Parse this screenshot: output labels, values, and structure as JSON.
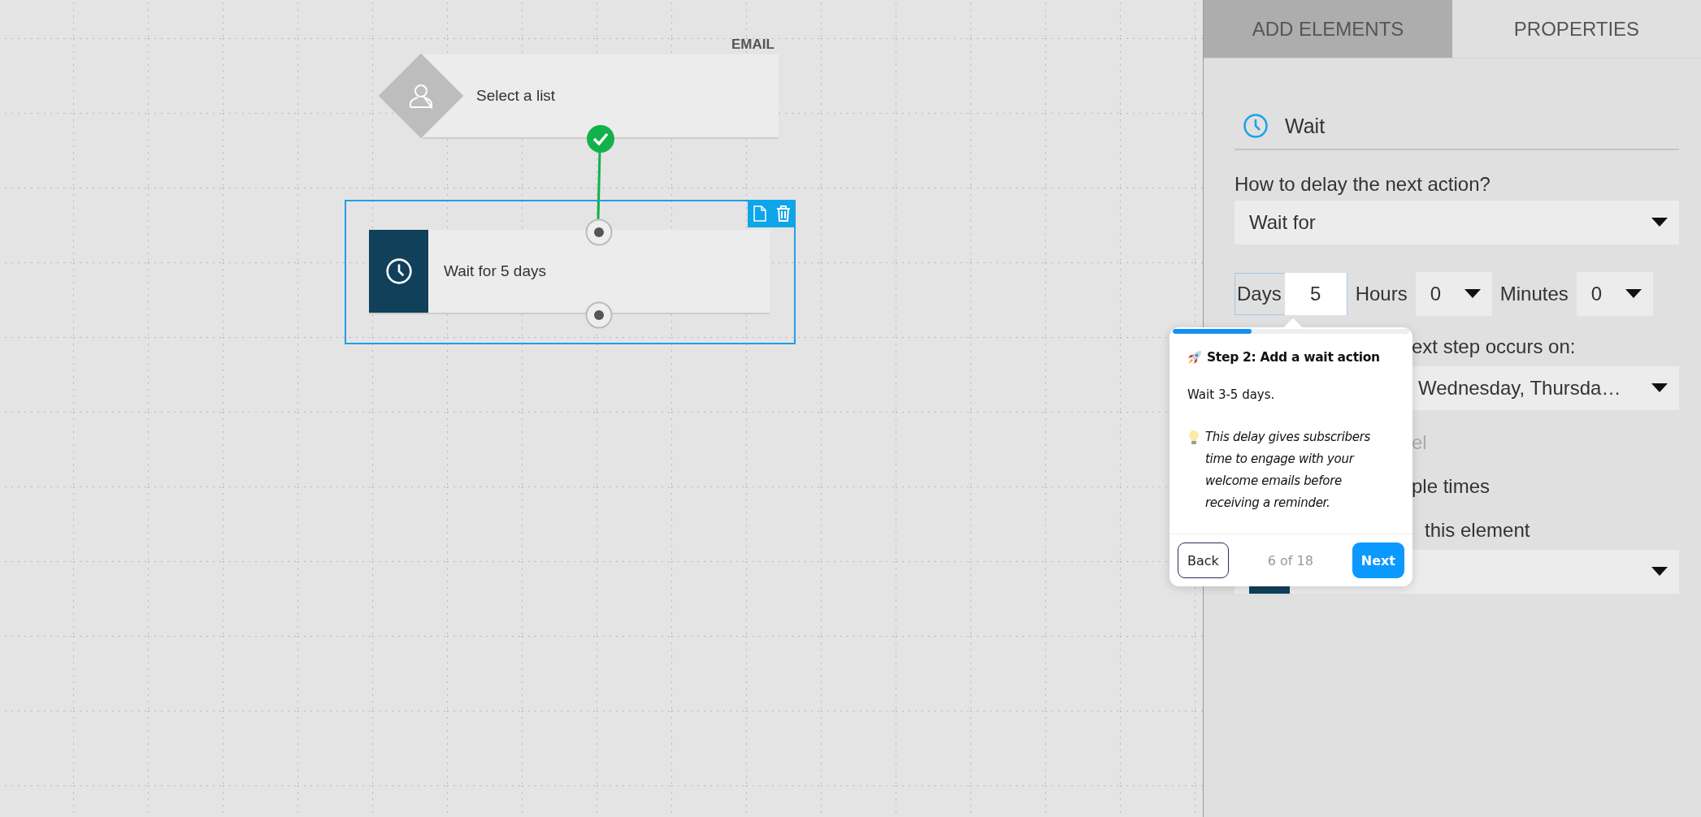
{
  "canvas": {
    "nodes": [
      {
        "kind": "trigger",
        "tag": "EMAIL",
        "label": "Select a list",
        "connected": true
      },
      {
        "kind": "wait",
        "label": "Wait for 5 days",
        "selected": true
      }
    ]
  },
  "panel": {
    "tabs": [
      {
        "label": "ADD ELEMENTS",
        "selected": false
      },
      {
        "label": "PROPERTIES",
        "selected": true
      }
    ],
    "header": {
      "title": "Wait"
    },
    "delay_label": "How to delay the next action?",
    "delay_mode": "Wait for",
    "duration": [
      {
        "label": "Days",
        "value": "5",
        "kind": "input"
      },
      {
        "label": "Hours",
        "value": "0",
        "kind": "select"
      },
      {
        "label": "Minutes",
        "value": "0",
        "kind": "select"
      }
    ],
    "covered_rows": [
      {
        "kind": "label",
        "text": "ext step occurs on:"
      },
      {
        "kind": "select",
        "text": "Wednesday, Thursda…"
      },
      {
        "kind": "label",
        "text": "el",
        "disabled": true
      },
      {
        "kind": "label",
        "text": "ple times"
      },
      {
        "kind": "label",
        "text": "this element"
      },
      {
        "kind": "swatch_select"
      }
    ]
  },
  "tour": {
    "title": "Step 2: Add a wait action",
    "body": "Wait 3-5 days.",
    "tip": "This delay gives subscribers time to engage with your welcome emails before receiving a reminder.",
    "level": 0.333,
    "counter": "6 of 18",
    "buttons": [
      {
        "label": "Back",
        "kind": "secondary"
      },
      {
        "label": "Next",
        "kind": "primary"
      }
    ]
  }
}
